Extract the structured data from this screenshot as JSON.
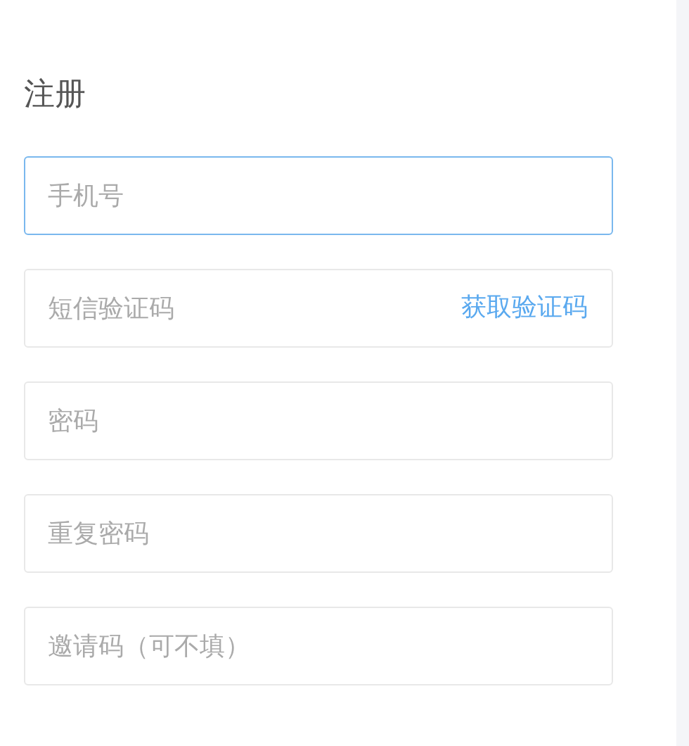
{
  "title": "注册",
  "fields": [
    {
      "placeholder": "手机号",
      "focused": true
    },
    {
      "placeholder": "短信验证码",
      "focused": false,
      "action": "获取验证码"
    },
    {
      "placeholder": "密码",
      "focused": false
    },
    {
      "placeholder": "重复密码",
      "focused": false
    },
    {
      "placeholder": "邀请码（可不填）",
      "focused": false
    }
  ]
}
